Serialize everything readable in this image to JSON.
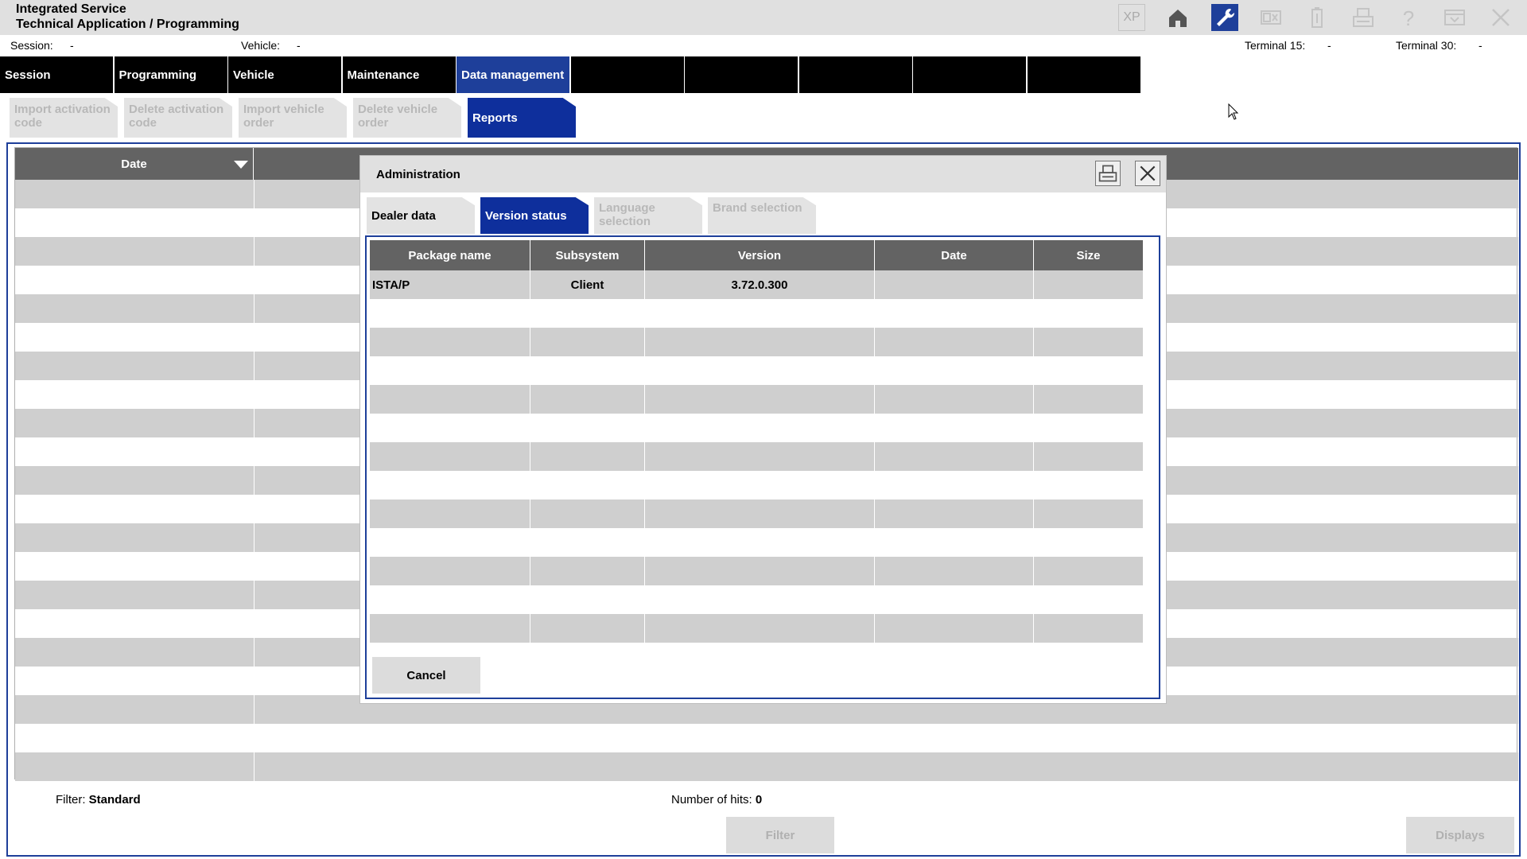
{
  "titlebar": {
    "line1": "Integrated Service",
    "line2": "Technical Application / Programming",
    "xp_label": "XP"
  },
  "sessionbar": {
    "session_label": "Session:",
    "session_value": "-",
    "vehicle_label": "Vehicle:",
    "vehicle_value": "-",
    "terminal15_label": "Terminal 15:",
    "terminal15_value": "-",
    "terminal30_label": "Terminal 30:",
    "terminal30_value": "-"
  },
  "mainnav": {
    "tabs": [
      "Session",
      "Programming",
      "Vehicle",
      "Maintenance",
      "Data management",
      "",
      "",
      "",
      "",
      ""
    ],
    "active_index": 4
  },
  "subnav": {
    "tabs": [
      "Import activation code",
      "Delete activation code",
      "Import vehicle order",
      "Delete vehicle order",
      "Reports"
    ],
    "active_index": 4
  },
  "background_table": {
    "date_header": "Date"
  },
  "footer": {
    "filter_label": "Filter:",
    "filter_value": "Standard",
    "hits_label": "Number of hits:",
    "hits_value": "0",
    "filter_button": "Filter",
    "displays_button": "Displays"
  },
  "dialog": {
    "title": "Administration",
    "tabs": [
      "Dealer data",
      "Version status",
      "Language selection",
      "Brand selection"
    ],
    "active_tab": 1,
    "columns": [
      "Package name",
      "Subsystem",
      "Version",
      "Date",
      "Size"
    ],
    "rows": [
      {
        "package": "ISTA/P",
        "subsystem": "Client",
        "version": "3.72.0.300",
        "date": "",
        "size": ""
      }
    ],
    "cancel_label": "Cancel"
  },
  "colors": {
    "accent_blue": "#1e3f9a",
    "header_gray": "#636363",
    "row_gray": "#cfcfcf",
    "nav_black": "#000000"
  }
}
